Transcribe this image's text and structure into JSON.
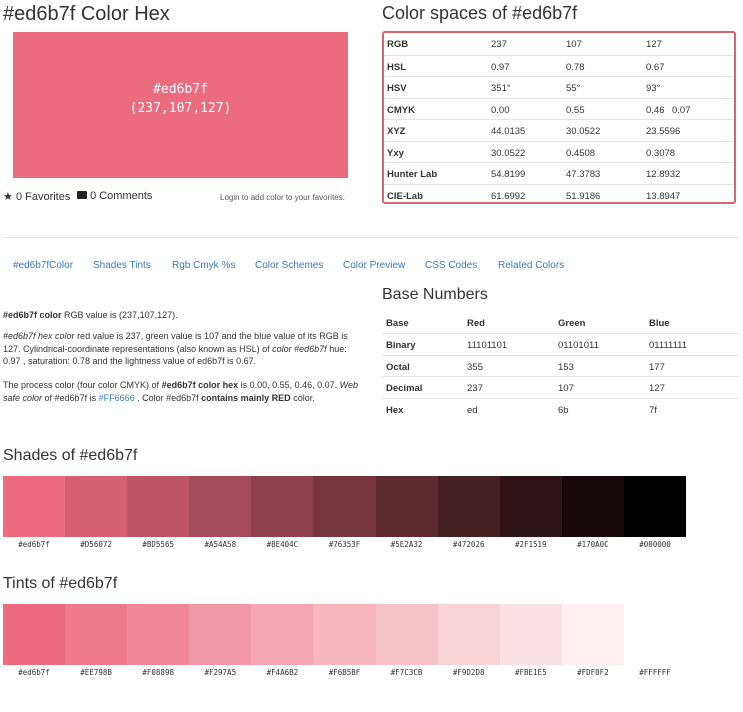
{
  "title": "#ed6b7f Color Hex",
  "swatch": {
    "hex": "#ed6b7f",
    "rgb": "(237,107,127)"
  },
  "favorites": "0 Favorites",
  "comments": "0 Comments",
  "login_hint": "Login to add color to your favorites.",
  "colorspaces": {
    "title": "Color spaces of #ed6b7f",
    "rows": [
      {
        "label": "RGB",
        "v1": "237",
        "v2": "107",
        "v3": "127",
        "v4": ""
      },
      {
        "label": "HSL",
        "v1": "0.97",
        "v2": "0.78",
        "v3": "0.67",
        "v4": ""
      },
      {
        "label": "HSV",
        "v1": "351°",
        "v2": "55°",
        "v3": "93°",
        "v4": ""
      },
      {
        "label": "CMYK",
        "v1": "0.00",
        "v2": "0.55",
        "v3": "0.46",
        "v4": "0.07"
      },
      {
        "label": "XYZ",
        "v1": "44.0135",
        "v2": "30.0522",
        "v3": "23.5596",
        "v4": ""
      },
      {
        "label": "Yxy",
        "v1": "30.0522",
        "v2": "0.4508",
        "v3": "0.3078",
        "v4": ""
      },
      {
        "label": "Hunter Lab",
        "v1": "54.8199",
        "v2": "47.3783",
        "v3": "12.8932",
        "v4": ""
      },
      {
        "label": "CIE-Lab",
        "v1": "61.6992",
        "v2": "51.9186",
        "v3": "13.8947",
        "v4": ""
      }
    ]
  },
  "tabs": [
    "#ed6b7fColor",
    "Shades Tints",
    "Rgb Cmyk %s",
    "Color Schemes",
    "Color Preview",
    "CSS Codes",
    "Related Colors"
  ],
  "desc": {
    "p1_bold": "#ed6b7f color",
    "p1_rest": " RGB value is (237,107,127).",
    "p2_i1": "#ed6b7f hex color",
    "p2_t1": " red value is 237, green value is 107 and the blue value of its RGB is 127. Cylindrical-coordinate representations (also known as HSL) of ",
    "p2_i2": "color #ed6b7f",
    "p2_t2": " hue: 0.97 , saturation: 0.78 and the lightness value of ed6b7f is 0.67.",
    "p3_t1": "The process color (four color CMYK) of ",
    "p3_b1": "#ed6b7f color hex",
    "p3_t2": " is 0.00, 0.55, 0.46, 0.07. ",
    "p3_i1": "Web safe color",
    "p3_t3": " of #ed6b7f is ",
    "p3_link": "#FF6666",
    "p3_t4": " . Color #ed6b7f ",
    "p3_b2": "contains mainly RED",
    "p3_t5": " color."
  },
  "base_numbers": {
    "title": "Base Numbers",
    "headers": [
      "Base",
      "Red",
      "Green",
      "Blue"
    ],
    "rows": [
      {
        "base": "Binary",
        "r": "11101101",
        "g": "01101011",
        "b": "01111111"
      },
      {
        "base": "Octal",
        "r": "355",
        "g": "153",
        "b": "177"
      },
      {
        "base": "Decimal",
        "r": "237",
        "g": "107",
        "b": "127"
      },
      {
        "base": "Hex",
        "r": "ed",
        "g": "6b",
        "b": "7f"
      }
    ]
  },
  "shades": {
    "title": "Shades of #ed6b7f",
    "codes": [
      "#ed6b7f",
      "#D56072",
      "#BD5565",
      "#A54A58",
      "#8E404C",
      "#76353F",
      "#5E2A32",
      "#472026",
      "#2F1519",
      "#170A0C",
      "#000000"
    ],
    "colors": [
      "#ed6b7f",
      "#d56072",
      "#bd5565",
      "#a54a58",
      "#8e404c",
      "#76353f",
      "#5e2a32",
      "#472026",
      "#2f1519",
      "#170a0c",
      "#000000"
    ]
  },
  "tints": {
    "title": "Tints of #ed6b7f",
    "codes": [
      "#ed6b7f",
      "#EE798B",
      "#F08898",
      "#F297A5",
      "#F4A6B2",
      "#F6B5BF",
      "#F7C3CB",
      "#F9D2D8",
      "#FBE1E5",
      "#FDF0F2",
      "#FFFFFF"
    ],
    "colors": [
      "#ed6b7f",
      "#ee798b",
      "#f08898",
      "#f297a5",
      "#f4a6b2",
      "#f6b5bf",
      "#f7c3cb",
      "#f9d2d8",
      "#fbe1e5",
      "#fdf0f2",
      "#ffffff"
    ]
  }
}
